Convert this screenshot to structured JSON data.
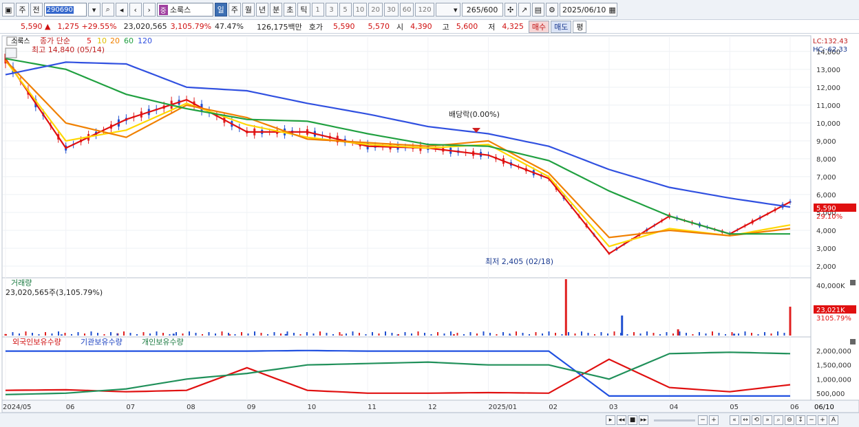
{
  "toolbar": {
    "period_main": "주",
    "prev_label": "전",
    "code": "290690",
    "name_tag": "중",
    "name": "소룩스",
    "periods": [
      "일",
      "주",
      "월",
      "년",
      "분",
      "초",
      "틱"
    ],
    "active_period": "일",
    "intervals": [
      "1",
      "3",
      "5",
      "10",
      "20",
      "30",
      "60",
      "120"
    ],
    "page": "265",
    "page_total": "/600",
    "date": "2025/06/10"
  },
  "quote": {
    "price": "5,590 ▲",
    "change": "1,275 +29.55%",
    "volume": "23,020,565",
    "vol_ratio": "3,105.79%",
    "turnover": "47.47%",
    "amount": "126,175백만",
    "ask_label": "호가",
    "ask": "5,590",
    "bid": "5,570",
    "open_label": "시",
    "open": "4,390",
    "high_label": "고",
    "high": "5,600",
    "low_label": "저",
    "low": "4,325",
    "buy": "매수",
    "sell": "매도",
    "eval": "평"
  },
  "legend": {
    "name": "소룩스",
    "ma_label": "종가 단순",
    "ma_periods": [
      "5",
      "10",
      "20",
      "60",
      "120"
    ],
    "ma_colors": [
      "#e01010",
      "#ffd700",
      "#f08000",
      "#20a040",
      "#3050e0"
    ],
    "max_note": "최고 14,840 (05/14)",
    "min_note": "최저 2,405 (02/18)",
    "dividend": "배당락(0.00%)",
    "lc": "LC:132.43",
    "hc": "HC:-62.33",
    "price_tag": "5,590",
    "price_pct": "29.10%"
  },
  "volume_panel": {
    "title": "거래량",
    "value": "23,020,565주(3,105.79%)",
    "tag": "23,021K",
    "tag_pct": "3105.79%"
  },
  "holding_panel": {
    "series": [
      "외국인보유수량",
      "기관보유수량",
      "개인보유수량"
    ]
  },
  "footer": {
    "right_label": "06/10"
  },
  "chart_data": [
    {
      "type": "line",
      "title": "소룩스",
      "y_ticks": [
        2000,
        3000,
        4000,
        5000,
        6000,
        7000,
        8000,
        9000,
        10000,
        11000,
        12000,
        13000,
        14000
      ],
      "y_tick_labels": [
        "2,000",
        "3,000",
        "4,000",
        "5,000",
        "6,000",
        "7,000",
        "8,000",
        "9,000",
        "10,000",
        "11,000",
        "12,000",
        "13,000",
        "14,000"
      ],
      "ylim": [
        1500,
        14800
      ],
      "x_labels": [
        "2024/05",
        "06",
        "07",
        "08",
        "09",
        "10",
        "11",
        "12",
        "2025/01",
        "02",
        "03",
        "04",
        "05",
        "06"
      ],
      "x": [
        "2024/05",
        "2024/06",
        "2024/07",
        "2024/08",
        "2024/09",
        "2024/10",
        "2024/11",
        "2024/12",
        "2025/01",
        "2025/02",
        "2025/03",
        "2025/04",
        "2025/05",
        "2025/06"
      ],
      "series": [
        {
          "name": "5",
          "values": [
            13600,
            8600,
            10200,
            11300,
            9500,
            9500,
            8700,
            8600,
            8200,
            6900,
            2700,
            4800,
            3800,
            5590
          ]
        },
        {
          "name": "10",
          "values": [
            13500,
            9000,
            9600,
            11100,
            9900,
            9200,
            8800,
            8600,
            8800,
            7000,
            3100,
            4100,
            3700,
            4300
          ]
        },
        {
          "name": "20",
          "values": [
            13500,
            10000,
            9200,
            11000,
            10300,
            9100,
            8900,
            8700,
            9000,
            7200,
            3600,
            4000,
            3700,
            4100
          ]
        },
        {
          "name": "60",
          "values": [
            13600,
            13000,
            11600,
            10800,
            10200,
            10100,
            9400,
            8800,
            8700,
            7900,
            6200,
            4800,
            3800,
            3800
          ]
        },
        {
          "name": "120",
          "values": [
            12700,
            13400,
            13300,
            12000,
            11800,
            11100,
            10500,
            9800,
            9400,
            8700,
            7400,
            6400,
            5800,
            5300
          ]
        }
      ]
    },
    {
      "type": "bar",
      "title": "거래량",
      "y_tick_labels": [
        "40,000K"
      ],
      "ylim": [
        0,
        45000
      ],
      "x": [
        "2024/05",
        "2024/06",
        "2024/07",
        "2024/08",
        "2024/09",
        "2024/10",
        "2024/11",
        "2024/12",
        "2025/01",
        "2025/02",
        "2025/02b",
        "2025/03",
        "2025/04",
        "2025/05",
        "2025/06"
      ],
      "values": [
        1200,
        900,
        1800,
        1500,
        1000,
        1200,
        800,
        900,
        1000,
        700,
        45000,
        16000,
        5000,
        1500,
        23021
      ]
    },
    {
      "type": "line",
      "title": "보유수량",
      "y_tick_labels": [
        "2,000,000",
        "1,500,000",
        "1,000,000",
        "500,000"
      ],
      "ylim": [
        300000,
        2200000
      ],
      "x": [
        "2024/05",
        "2024/06",
        "2024/07",
        "2024/08",
        "2024/09",
        "2024/10",
        "2024/11",
        "2024/12",
        "2025/01",
        "2025/02",
        "2025/03",
        "2025/04",
        "2025/05",
        "2025/06"
      ],
      "series": [
        {
          "name": "외국인보유수량",
          "values": [
            600000,
            620000,
            550000,
            600000,
            1400000,
            600000,
            500000,
            500000,
            520000,
            500000,
            1700000,
            700000,
            550000,
            800000
          ]
        },
        {
          "name": "기관보유수량",
          "values": [
            1990000,
            1990000,
            1990000,
            1990000,
            1990000,
            2010000,
            1990000,
            1990000,
            1990000,
            1990000,
            400000,
            400000,
            400000,
            400000
          ]
        },
        {
          "name": "개인보유수량",
          "values": [
            450000,
            500000,
            650000,
            1000000,
            1200000,
            1500000,
            1550000,
            1600000,
            1500000,
            1500000,
            1000000,
            1900000,
            1950000,
            1900000
          ]
        }
      ]
    }
  ]
}
